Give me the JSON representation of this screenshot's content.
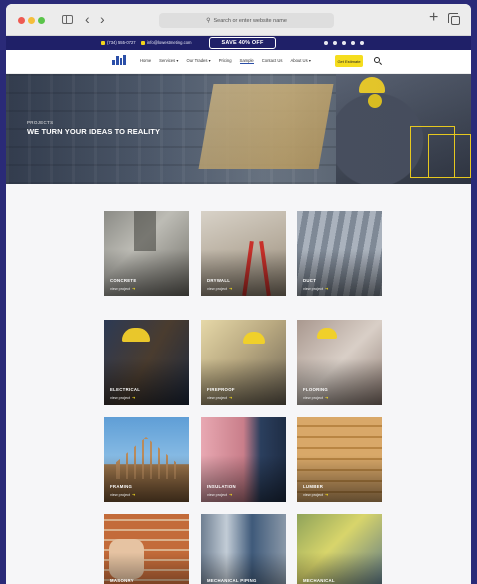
{
  "browser": {
    "address_placeholder": "Search or enter website name"
  },
  "topbar": {
    "phone": "(734) 555-0727",
    "email": "info@lowestmeting.com",
    "promo": "SAVE 40% OFF"
  },
  "nav": {
    "items": [
      "Home",
      "Services ▾",
      "Our Trades ▾",
      "Pricing",
      "Sample",
      "Contact Us",
      "About Us ▾"
    ],
    "active_item": "Sample",
    "cta": "Get Estimate"
  },
  "hero": {
    "kicker": "PROJECTS",
    "title": "WE TURN YOUR IDEAS TO REALITY"
  },
  "projects": {
    "link_label": "view project",
    "items": [
      {
        "title": "CONCRETE"
      },
      {
        "title": "DRYWALL"
      },
      {
        "title": "DUCT"
      },
      {
        "title": "ELECTRICAL"
      },
      {
        "title": "FIREPROOF"
      },
      {
        "title": "FLOORING"
      },
      {
        "title": "FRAMING"
      },
      {
        "title": "INSULATION"
      },
      {
        "title": "LUMBER"
      },
      {
        "title": "MASONRY"
      },
      {
        "title": "MECHANICAL PIPING"
      },
      {
        "title": "MECHANICAL"
      }
    ]
  },
  "colors": {
    "topbar_bg": "#1f2068",
    "accent_yellow": "#f5dd1e",
    "brand_blue": "#2b4fa8"
  }
}
